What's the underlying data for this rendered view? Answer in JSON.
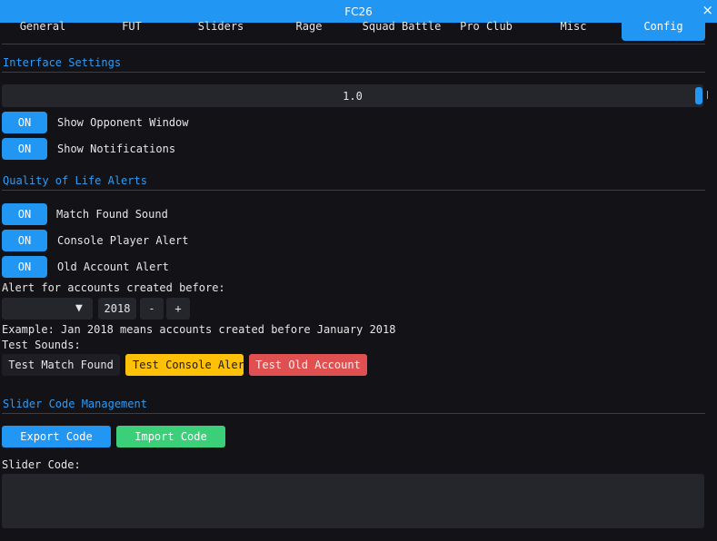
{
  "window": {
    "title": "FC26",
    "close_glyph": "×"
  },
  "tabs": [
    {
      "label": "General"
    },
    {
      "label": "FUT"
    },
    {
      "label": "Sliders"
    },
    {
      "label": "Rage"
    },
    {
      "label": "Squad Battle"
    },
    {
      "label": "Pro Club"
    },
    {
      "label": "Misc"
    },
    {
      "label": "Config",
      "active": true
    }
  ],
  "interface": {
    "title": "Interface Settings",
    "scale_value": "1.0",
    "toggles": [
      {
        "state": "ON",
        "label": "Show Opponent Window"
      },
      {
        "state": "ON",
        "label": "Show Notifications"
      }
    ]
  },
  "qol": {
    "title": "Quality of Life Alerts",
    "toggles": [
      {
        "state": "ON",
        "label": "Match Found Sound"
      },
      {
        "state": "ON",
        "label": "Console Player Alert"
      },
      {
        "state": "ON",
        "label": "Old Account Alert"
      }
    ],
    "alert_label": "Alert for accounts created before:",
    "month_value": "",
    "combo_arrow": "▼",
    "year_value": "2018",
    "minus": "-",
    "plus": "+",
    "example": "Example: Jan 2018 means accounts created before January 2018",
    "test_label": "Test Sounds:",
    "test_buttons": [
      {
        "label": "Test Match Found"
      },
      {
        "label": "Test Console Alert"
      },
      {
        "label": "Test Old Account"
      }
    ]
  },
  "slider_code": {
    "title": "Slider Code Management",
    "export_label": "Export Code",
    "import_label": "Import Code",
    "code_label": "Slider Code:",
    "code_value": ""
  },
  "colors": {
    "accent": "#2196f3",
    "section_title": "#2e9cf3",
    "warning": "#ffc107",
    "danger": "#e05050",
    "success": "#3ccf7a",
    "background": "#121217",
    "frame": "#25252c"
  }
}
